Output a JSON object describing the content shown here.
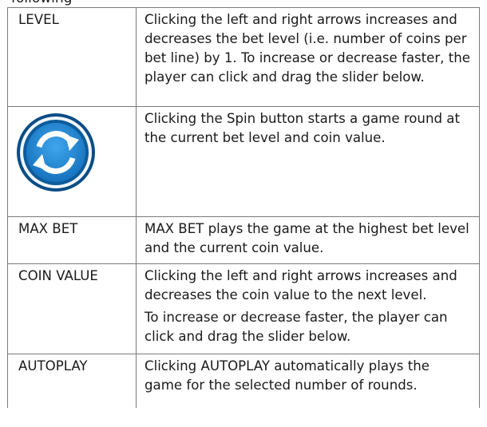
{
  "page": {
    "cut_off_heading": "following"
  },
  "rows": [
    {
      "label": "LEVEL",
      "description": [
        "Clicking the left and right arrows increases and decreases the bet level (i.e. number of coins per bet line) by 1. To increase or decrease faster, the player can click and drag the slider below."
      ]
    },
    {
      "icon": "spin-button-icon",
      "description": [
        "Clicking the Spin button starts a game round at the current bet level and coin value."
      ]
    },
    {
      "label": "MAX BET",
      "description": [
        "MAX BET plays the game at the highest bet level and the current coin value."
      ]
    },
    {
      "label": "COIN VALUE",
      "description": [
        "Clicking the left and right arrows increases and decreases the coin value to the next level.",
        "To increase or decrease faster, the player can click and drag the slider below."
      ]
    },
    {
      "label": "AUTOPLAY",
      "description": [
        "Clicking AUTOPLAY automatically plays the game for the selected number of rounds."
      ]
    }
  ],
  "colors": {
    "border": "#7a7a7a",
    "text": "#1a1a1a",
    "spin_icon_outer": "#0a4d86",
    "spin_icon_inner": "#1e86d2",
    "spin_icon_arrows": "#ffffff"
  }
}
